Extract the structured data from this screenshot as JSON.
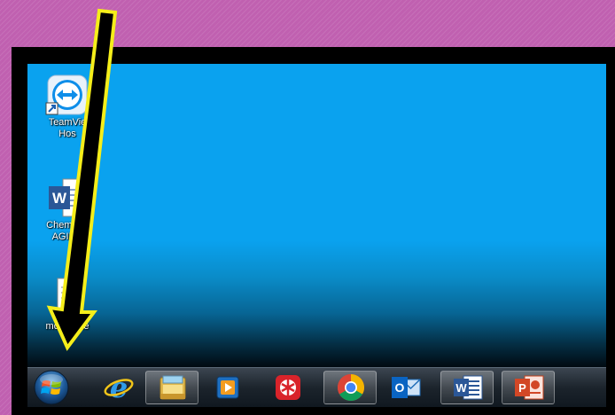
{
  "desktop": {
    "icons": [
      {
        "label": "TeamVie\nHos",
        "icon": "teamviewer-shortcut-icon"
      },
      {
        "label": "Chemi        fer\nAGIF    0",
        "icon": "word-document-icon"
      },
      {
        "label": "mdp        gerie",
        "icon": "text-document-icon"
      }
    ]
  },
  "taskbar": {
    "start_button": {
      "icon": "windows-start-orb-icon"
    },
    "pinned": [
      {
        "icon": "internet-explorer-icon",
        "active": false
      },
      {
        "icon": "file-explorer-icon",
        "active": true
      },
      {
        "icon": "media-player-icon",
        "active": false
      },
      {
        "icon": "red-app-icon",
        "active": false
      },
      {
        "icon": "chrome-icon",
        "active": true
      },
      {
        "icon": "outlook-icon",
        "active": false
      },
      {
        "icon": "word-icon",
        "active": true
      },
      {
        "icon": "powerpoint-icon",
        "active": true
      }
    ],
    "word_icon_letter": "W",
    "outlook_icon_letter": "O",
    "powerpoint_icon_letter": "P",
    "ie_icon_letter": "e"
  },
  "annotation": {
    "color": "#f5ee1a",
    "icon": "yellow-arrow-icon"
  },
  "colors": {
    "background": "#c060b0",
    "desktop": "#0aa2ef",
    "taskbar": "#1c242c"
  }
}
